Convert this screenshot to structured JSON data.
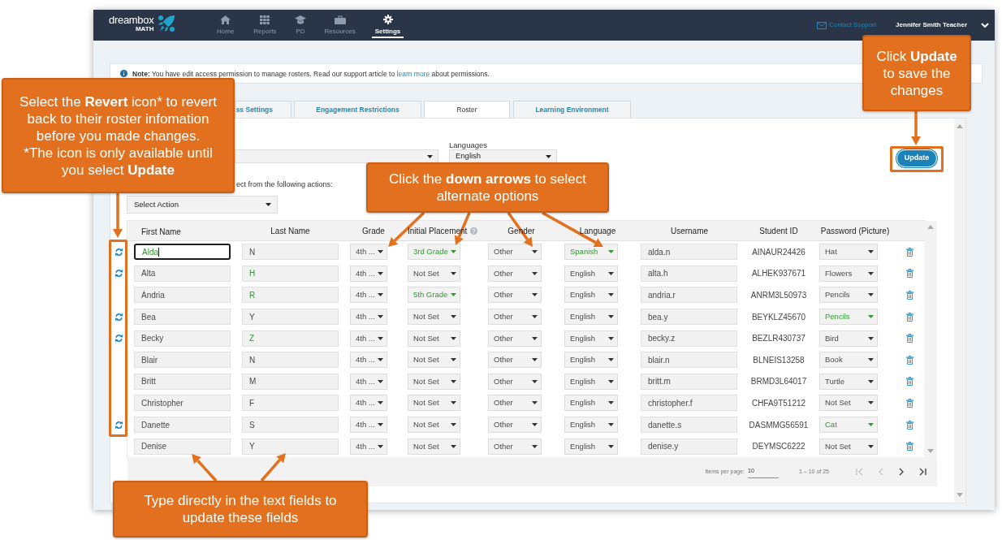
{
  "nav": {
    "logo": {
      "name": "dreambox",
      "subtitle": "MATH"
    },
    "items": [
      {
        "kind": "home",
        "label": "Home",
        "selected": false
      },
      {
        "kind": "reports",
        "label": "Reports",
        "selected": false
      },
      {
        "kind": "pd",
        "label": "PD",
        "selected": false
      },
      {
        "kind": "resources",
        "label": "Resources",
        "selected": false
      },
      {
        "kind": "settings",
        "label": "Settings",
        "selected": true
      }
    ],
    "contact": "Contact Support",
    "user": "Jennifer Smith Teacher"
  },
  "note": {
    "before": "**Note:** You have edit access permission to manage rosters. Read our support article to ",
    "link": "learn more",
    "after": " about permissions."
  },
  "tabs": [
    {
      "label": "ss Settings",
      "selected": false
    },
    {
      "label": "Engagement Restrictions",
      "selected": false
    },
    {
      "label": "Roster",
      "selected": true
    },
    {
      "label": "Learning Environment",
      "selected": false
    }
  ],
  "filters": [
    {
      "kind": "select"
    },
    {
      "kind": "select",
      "label": "Languages",
      "value": "English"
    }
  ],
  "actions": {
    "prompt": "ect from the following actions:",
    "select": "Select Action"
  },
  "update_button": "Update",
  "table": {
    "columns": [
      {
        "label": "First Name",
        "help": false
      },
      {
        "label": "Last Name",
        "help": false
      },
      {
        "label": "Grade",
        "help": false
      },
      {
        "label": "Initial Placement",
        "help": true
      },
      {
        "label": "Gender",
        "help": false
      },
      {
        "label": "Language",
        "help": false
      },
      {
        "label": "Username",
        "help": false
      },
      {
        "label": "Student ID",
        "help": false
      },
      {
        "label": "Password (Picture)",
        "help": false
      }
    ],
    "rows": [
      {
        "revert": true,
        "first_name": {
          "value": "Alda",
          "changed": true,
          "focused": true
        },
        "last_name": {
          "value": "N",
          "changed": false
        },
        "grade": {
          "value": "4th ...",
          "changed": false
        },
        "initial_placement": {
          "value": "3rd Grade",
          "changed": true
        },
        "gender": {
          "value": "Other",
          "changed": false
        },
        "language": {
          "value": "Spanish",
          "changed": true
        },
        "username": "alda.n",
        "student_id": "AINAUR24426",
        "password": {
          "value": "Hat",
          "changed": false
        }
      },
      {
        "revert": true,
        "first_name": {
          "value": "Alta",
          "changed": false,
          "focused": false
        },
        "last_name": {
          "value": "H",
          "changed": true
        },
        "grade": {
          "value": "4th ...",
          "changed": false
        },
        "initial_placement": {
          "value": "Not Set",
          "changed": false
        },
        "gender": {
          "value": "Other",
          "changed": false
        },
        "language": {
          "value": "English",
          "changed": false
        },
        "username": "alta.h",
        "student_id": "ALHEK937671",
        "password": {
          "value": "Flowers",
          "changed": false
        }
      },
      {
        "revert": false,
        "first_name": {
          "value": "Andria",
          "changed": false,
          "focused": false
        },
        "last_name": {
          "value": "R",
          "changed": true
        },
        "grade": {
          "value": "4th ...",
          "changed": false
        },
        "initial_placement": {
          "value": "5th Grade",
          "changed": true
        },
        "gender": {
          "value": "Other",
          "changed": false
        },
        "language": {
          "value": "English",
          "changed": false
        },
        "username": "andria.r",
        "student_id": "ANRM3L50973",
        "password": {
          "value": "Pencils",
          "changed": false
        }
      },
      {
        "revert": true,
        "first_name": {
          "value": "Bea",
          "changed": false,
          "focused": false
        },
        "last_name": {
          "value": "Y",
          "changed": false
        },
        "grade": {
          "value": "4th ...",
          "changed": false
        },
        "initial_placement": {
          "value": "Not Set",
          "changed": false
        },
        "gender": {
          "value": "Other",
          "changed": false
        },
        "language": {
          "value": "English",
          "changed": false
        },
        "username": "bea.y",
        "student_id": "BEYKLZ45670",
        "password": {
          "value": "Pencils",
          "changed": true
        }
      },
      {
        "revert": true,
        "first_name": {
          "value": "Becky",
          "changed": false,
          "focused": false
        },
        "last_name": {
          "value": "Z",
          "changed": true
        },
        "grade": {
          "value": "4th ...",
          "changed": false
        },
        "initial_placement": {
          "value": "Not Set",
          "changed": false
        },
        "gender": {
          "value": "Other",
          "changed": false
        },
        "language": {
          "value": "English",
          "changed": false
        },
        "username": "becky.z",
        "student_id": "BEZLR430737",
        "password": {
          "value": "Bird",
          "changed": false
        }
      },
      {
        "revert": false,
        "first_name": {
          "value": "Blair",
          "changed": false,
          "focused": false
        },
        "last_name": {
          "value": "N",
          "changed": false
        },
        "grade": {
          "value": "4th ...",
          "changed": false
        },
        "initial_placement": {
          "value": "Not Set",
          "changed": false
        },
        "gender": {
          "value": "Other",
          "changed": false
        },
        "language": {
          "value": "English",
          "changed": false
        },
        "username": "blair.n",
        "student_id": "BLNEIS13258",
        "password": {
          "value": "Book",
          "changed": false
        }
      },
      {
        "revert": false,
        "first_name": {
          "value": "Britt",
          "changed": false,
          "focused": false
        },
        "last_name": {
          "value": "M",
          "changed": false
        },
        "grade": {
          "value": "4th ...",
          "changed": false
        },
        "initial_placement": {
          "value": "Not Set",
          "changed": false
        },
        "gender": {
          "value": "Other",
          "changed": false
        },
        "language": {
          "value": "English",
          "changed": false
        },
        "username": "britt.m",
        "student_id": "BRMD3L64017",
        "password": {
          "value": "Turtle",
          "changed": false
        }
      },
      {
        "revert": false,
        "first_name": {
          "value": "Christopher",
          "changed": false,
          "focused": false
        },
        "last_name": {
          "value": "F",
          "changed": false
        },
        "grade": {
          "value": "4th ...",
          "changed": false
        },
        "initial_placement": {
          "value": "Not Set",
          "changed": false
        },
        "gender": {
          "value": "Other",
          "changed": false
        },
        "language": {
          "value": "English",
          "changed": false
        },
        "username": "christopher.f",
        "student_id": "CHFA9T51212",
        "password": {
          "value": "Not Set",
          "changed": false
        }
      },
      {
        "revert": true,
        "first_name": {
          "value": "Danette",
          "changed": false,
          "focused": false
        },
        "last_name": {
          "value": "S",
          "changed": false
        },
        "grade": {
          "value": "4th ...",
          "changed": false
        },
        "initial_placement": {
          "value": "Not Set",
          "changed": false
        },
        "gender": {
          "value": "Other",
          "changed": false
        },
        "language": {
          "value": "English",
          "changed": false
        },
        "username": "danette.s",
        "student_id": "DASMMG56591",
        "password": {
          "value": "Cat",
          "changed": true
        }
      },
      {
        "revert": false,
        "first_name": {
          "value": "Denise",
          "changed": false,
          "focused": false
        },
        "last_name": {
          "value": "Y",
          "changed": false
        },
        "grade": {
          "value": "4th ...",
          "changed": false
        },
        "initial_placement": {
          "value": "Not Set",
          "changed": false
        },
        "gender": {
          "value": "Other",
          "changed": false
        },
        "language": {
          "value": "English",
          "changed": false
        },
        "username": "denise.y",
        "student_id": "DEYMSC6222",
        "password": {
          "value": "Not Set",
          "changed": false
        }
      }
    ]
  },
  "pagination": {
    "label": "Items per page:",
    "page_size": "10",
    "range": "1 – 10 of 25",
    "buttons": [
      {
        "kind": "first",
        "disabled": true
      },
      {
        "kind": "previous",
        "disabled": true
      },
      {
        "kind": "next",
        "disabled": false
      },
      {
        "kind": "last",
        "disabled": false
      }
    ]
  },
  "callouts": [
    {
      "paragraphs": [
        "Select the **Revert** icon* to revert back to their roster infomation before you made changes.",
        "*The icon is only available until you select **Update**"
      ]
    },
    {
      "paragraphs": [
        "Click **Update** to save the changes"
      ]
    },
    {
      "paragraphs": [
        "Click the **down arrows** to select alternate options"
      ]
    },
    {
      "paragraphs": [
        "Type directly in the text fields to update these fields"
      ]
    }
  ]
}
